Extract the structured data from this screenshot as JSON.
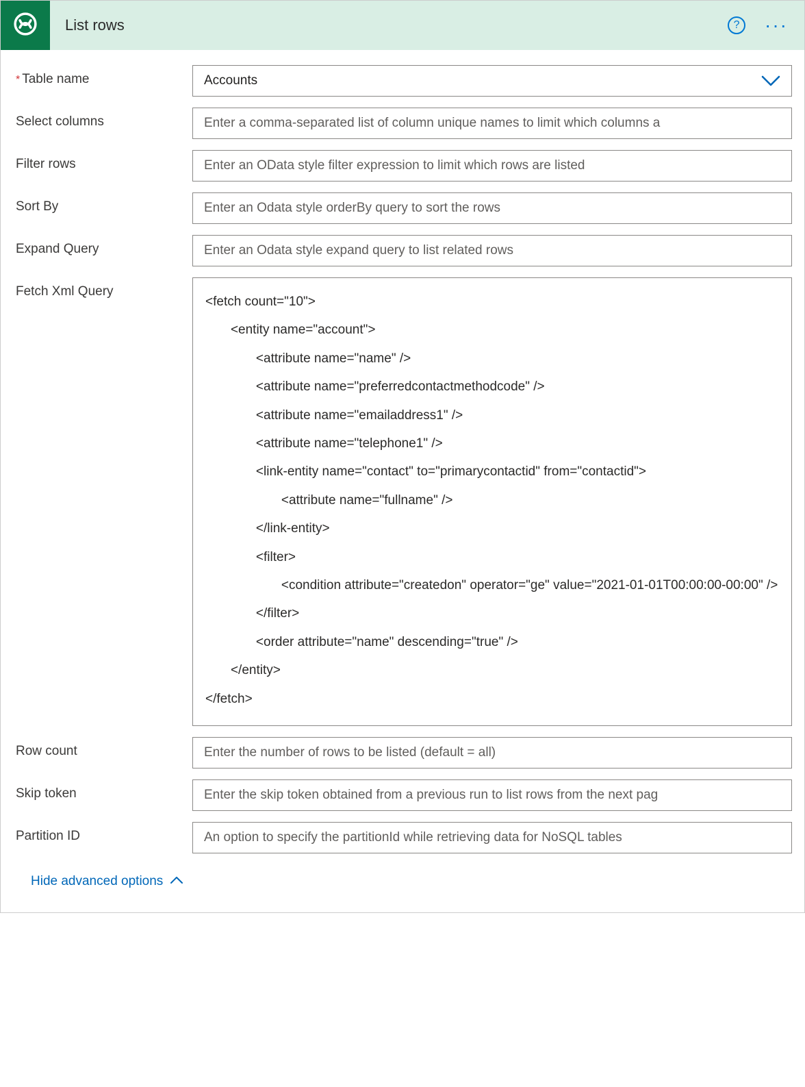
{
  "header": {
    "title": "List rows",
    "help_aria": "Help",
    "more_aria": "More"
  },
  "fields": {
    "table_name": {
      "label": "Table name",
      "value": "Accounts"
    },
    "select_columns": {
      "label": "Select columns",
      "placeholder": "Enter a comma-separated list of column unique names to limit which columns a"
    },
    "filter_rows": {
      "label": "Filter rows",
      "placeholder": "Enter an OData style filter expression to limit which rows are listed"
    },
    "sort_by": {
      "label": "Sort By",
      "placeholder": "Enter an Odata style orderBy query to sort the rows"
    },
    "expand_query": {
      "label": "Expand Query",
      "placeholder": "Enter an Odata style expand query to list related rows"
    },
    "fetch_xml": {
      "label": "Fetch Xml Query",
      "value": "<fetch count=\"10\">\n       <entity name=\"account\">\n              <attribute name=\"name\" />\n              <attribute name=\"preferredcontactmethodcode\" />\n              <attribute name=\"emailaddress1\" />\n              <attribute name=\"telephone1\" />\n              <link-entity name=\"contact\" to=\"primarycontactid\" from=\"contactid\">\n                     <attribute name=\"fullname\" />\n              </link-entity>\n              <filter>\n                     <condition attribute=\"createdon\" operator=\"ge\" value=\"2021-01-01T00:00:00-00:00\" />\n              </filter>\n              <order attribute=\"name\" descending=\"true\" />\n       </entity>\n</fetch>"
    },
    "row_count": {
      "label": "Row count",
      "placeholder": "Enter the number of rows to be listed (default = all)"
    },
    "skip_token": {
      "label": "Skip token",
      "placeholder": "Enter the skip token obtained from a previous run to list rows from the next pag"
    },
    "partition_id": {
      "label": "Partition ID",
      "placeholder": "An option to specify the partitionId while retrieving data for NoSQL tables"
    }
  },
  "footer": {
    "toggle_label": "Hide advanced options"
  }
}
